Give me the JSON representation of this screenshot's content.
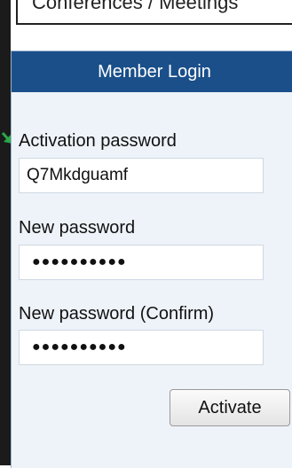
{
  "top_tab": {
    "label": "Conferences / Meetings"
  },
  "login_panel": {
    "title": "Member Login",
    "activation_password": {
      "label": "Activation password",
      "value": "Q7Mkdguamf"
    },
    "new_password": {
      "label": "New password",
      "mask": "●●●●●●●●●●"
    },
    "confirm_password": {
      "label": "New password (Confirm)",
      "mask": "●●●●●●●●●●"
    },
    "activate_button": "Activate"
  },
  "colors": {
    "header_bg": "#1a4f8a",
    "panel_bg": "#eef3f9",
    "arrow": "#2aa84a"
  }
}
